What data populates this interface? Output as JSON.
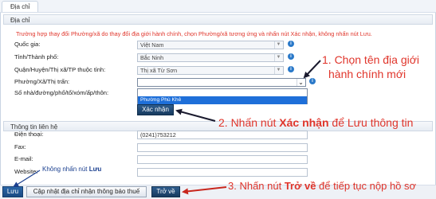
{
  "tabs": {
    "address_tab": "Địa chỉ"
  },
  "address_group": {
    "header": "Địa chỉ",
    "notice": "Trường hợp thay đổi Phường/xã do thay đổi địa giới hành chính, chọn Phường/xã tương ứng và nhấn nút Xác nhận, không nhấn nút Lưu.",
    "fields": {
      "country_label": "Quốc gia:",
      "country_value": "Việt Nam",
      "province_label": "Tỉnh/Thành phố:",
      "province_value": "Bắc Ninh",
      "district_label": "Quận/Huyện/Thị xã/TP thuộc tỉnh:",
      "district_value": "Thị xã Từ Sơn",
      "ward_label": "Phường/Xã/Thị trấn:",
      "ward_value": "",
      "street_label": "Số nhà/đường/phố/tổ/xóm/ấp/thôn:"
    },
    "dropdown_option": "Phường Phù Khê",
    "confirm_button": "Xác nhận"
  },
  "contact_group": {
    "header": "Thông tin liên hệ",
    "phone_label": "Điện thoại:",
    "phone_value": "(0241)753212",
    "fax_label": "Fax:",
    "email_label": "E-mail:",
    "website_label": "Website:"
  },
  "buttons": {
    "save": "Lưu",
    "update_notice_address": "Cập nhật địa chỉ nhận thông báo thuế",
    "back": "Trở về"
  },
  "annotations": {
    "step1_line1": "1. Chọn tên địa giới",
    "step1_line2": "hành chính mới",
    "step2_prefix": "2. Nhấn nút ",
    "step2_bold": "Xác nhận",
    "step2_suffix": " để Lưu thông tin",
    "step3_prefix": "3. Nhấn nút ",
    "step3_bold": "Trở về",
    "step3_suffix": " để tiếp tục nộp hồ sơ",
    "save_hint_prefix": "Không nhấn nút ",
    "save_hint_bold": "Lưu"
  },
  "colors": {
    "annotation_red": "#e0352b",
    "annotation_blue": "#1a3f8f",
    "selected_option": "#1e6fd9",
    "info_icon": "#2a79c9"
  }
}
